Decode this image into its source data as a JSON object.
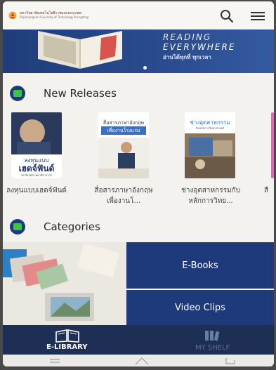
{
  "header": {
    "logo_line1": "มหาวิทยาลัยเทคโนโลยีราชมงคลกรุงเทพ",
    "logo_line2": "Rajamangala University of Technology Krungthep",
    "logo_icon": "university-seal-icon",
    "search_icon": "search-icon",
    "menu_icon": "hamburger-menu-icon"
  },
  "banner": {
    "line1": "READING",
    "line2": "EVERYWHERE",
    "line3": "อ่านได้ทุกที่ ทุกเวลา"
  },
  "new_releases": {
    "title": "New Releases",
    "books": [
      {
        "cover_line1": "ลงทุนแบบ",
        "cover_line2": "เฮดจ์ฟันด์",
        "cover_author": "ดร.นิเวศน์ เหมวชิรวรากร",
        "title": "ลงทุนแบบเฮดจ์ฟันด์"
      },
      {
        "cover_line1": "สื่อสารภาษาอังกฤษ",
        "cover_line2": "เพื่องานโรงแรม",
        "cover_author": "",
        "title": "สื่อสารภาษาอังกฤษเพื่องานโ..."
      },
      {
        "cover_line1": "ช่างอุตสาหกรรม",
        "cover_line2": "กับหลักการวิทยาศาสตร์",
        "cover_author": "",
        "title": "ช่างอุตสาหกรรมกับหลักการวิทย..."
      },
      {
        "cover_line1": "",
        "cover_line2": "",
        "cover_author": "",
        "title": "สื"
      }
    ]
  },
  "categories": {
    "title": "Categories",
    "items": [
      "E-Books",
      "Video Clips"
    ]
  },
  "bottom_nav": {
    "elibrary_label": "E-LIBRARY",
    "myshelf_label": "MY SHELF"
  },
  "colors": {
    "primary_navy": "#1f3a7a",
    "accent_green": "#3cc24a",
    "brand_red": "#b03a2e"
  }
}
